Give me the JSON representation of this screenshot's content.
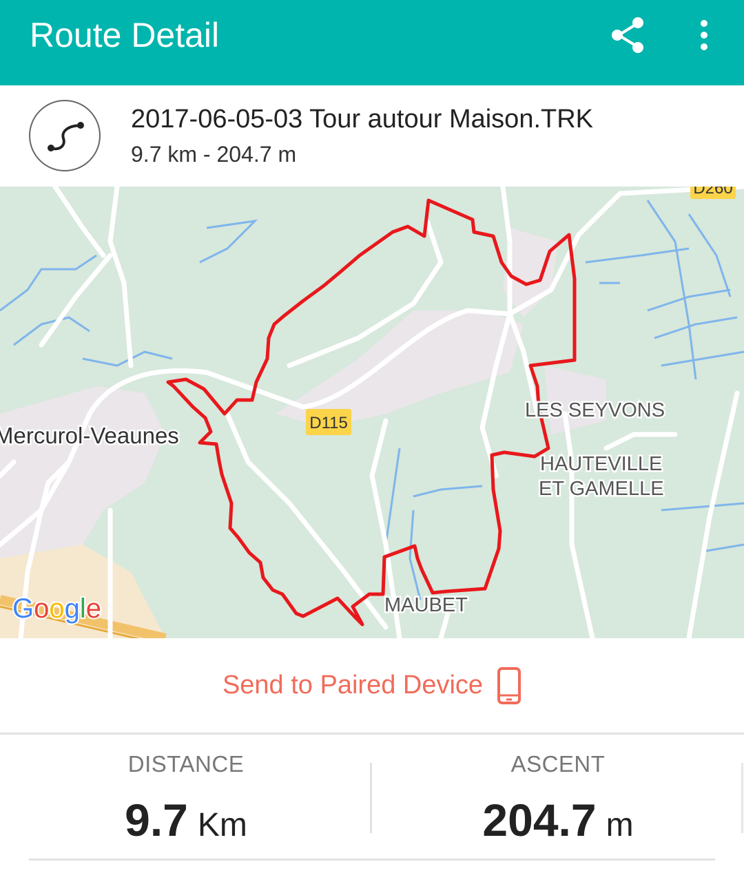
{
  "appbar": {
    "title": "Route Detail",
    "share_icon": "share-icon",
    "menu_icon": "more-vert-icon",
    "background": "#00b5ad"
  },
  "route": {
    "name": "2017-06-05-03 Tour autour Maison.TRK",
    "summary": "9.7 km - 204.7 m",
    "icon": "route-icon"
  },
  "map": {
    "labels": {
      "town": "Mercurol-Veaunes",
      "les_seyvons": "LES SEYVONS",
      "hauteville_1": "HAUTEVILLE",
      "hauteville_2": "ET GAMELLE",
      "maubet": "MAUBET",
      "road_d115": "D115",
      "road_d260": "D260",
      "google": "Google"
    },
    "route_color": "#e8181c"
  },
  "send": {
    "label": "Send to Paired Device",
    "icon": "phone-icon",
    "color": "#f26b5a"
  },
  "stats": {
    "distance": {
      "label": "DISTANCE",
      "value": "9.7",
      "unit": "Km"
    },
    "ascent": {
      "label": "ASCENT",
      "value": "204.7",
      "unit": "m"
    }
  }
}
